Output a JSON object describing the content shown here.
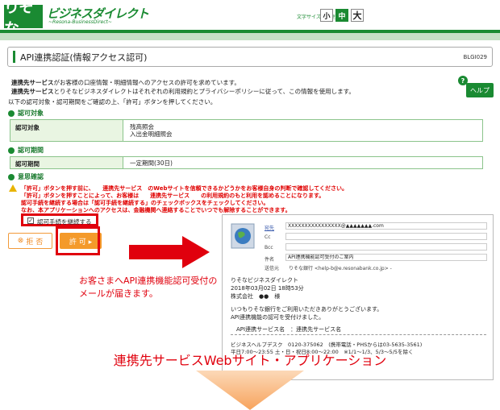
{
  "header": {
    "logo": "りそな",
    "brand_name": "ビジネスダイレクト",
    "brand_sub": "~Resona-BusinessDirect~",
    "font_size_label": "文字サイズを変更",
    "font_sizes": [
      "小",
      "中",
      "大"
    ]
  },
  "title": {
    "text": "API連携認証(情報アクセス認可)",
    "code": "BLGI029"
  },
  "help": {
    "label": "ヘルプ",
    "q": "?"
  },
  "intro": {
    "line1_b": "連携先サービス",
    "line1": "がお客様の口座情報・明細情報へのアクセスの許可を求めています。",
    "line2_b": "連携先サービス",
    "line2": "とりそなビジネスダイレクトはそれぞれの利用規約とプライバシーポリシーに従って、この情報を使用します。",
    "line3": "以下の認可対象・認可期間をご確認の上、「許可」ボタンを押してください。"
  },
  "sections": {
    "target": "認可対象",
    "period": "認可期間",
    "consent": "意思確認"
  },
  "table": {
    "target_label": "認可対象",
    "target_value1": "残高照会",
    "target_value2": "入出金明細照会",
    "period_label": "認可期間",
    "period_value": "一定期間(30日)"
  },
  "warnings": [
    "「許可」ボタンを押す前に、　　連携先サービス　のWebサイトを信頼できるかどうかをお客様自身の判断で確認してください。",
    "「許可」ボタンを押すことによって、お客様は　　連携先サービス　　の利用規約のもと利用を認めることになります。",
    "認可手続を継続する場合は「認可手続を継続する」のチェックボックスをチェックしてください。",
    "なお、本アプリケーションへのアクセスは、金融機関へ連絡することでいつでも解除することができます。"
  ],
  "checkbox": {
    "label": "認可手続を継続する",
    "mark": "✓"
  },
  "buttons": {
    "reject": "拒 否",
    "allow": "許 可 ▸",
    "reject_icon": "⊗"
  },
  "note": {
    "line1": "お客さまへAPI連携機能認可受付の",
    "line2": "メールが届きます。"
  },
  "email": {
    "to_label": "宛先",
    "to": "XXXXXXXXXXXXXXXX@▲▲▲▲▲▲▲.com",
    "cc_label": "Cc",
    "bcc_label": "Bcc",
    "subject_label": "件名",
    "subject": "API連携機能認可受付のご案内",
    "from_label": "送信元",
    "from": "りそな銀行 <help-b@e.resonabank.co.jp> -",
    "body": [
      "りそなビジネスダイレクト",
      "2018年03月02日 18時53分",
      "株式会社　●●　様",
      "",
      "いつもりそな銀行をご利用いただきありがとうございます。",
      "API連携機能の認可を受付けました。",
      "",
      "　API連携サービス名　：連携先サービス名"
    ],
    "footer": [
      "ビジネスヘルプデスク　0120-375062　(携帯電話・PHSからは03-5635-3561)",
      "平日7:00～23:55 土・日・祝日8:00～22:00　※1/1～1/3、5/3～5/5を除く"
    ]
  },
  "footer": {
    "title": "連携先サービスWebサイト・アプリケーション"
  },
  "colors": {
    "green": "#1a8a32",
    "red": "#e0000d",
    "orange": "#f49a2a"
  }
}
